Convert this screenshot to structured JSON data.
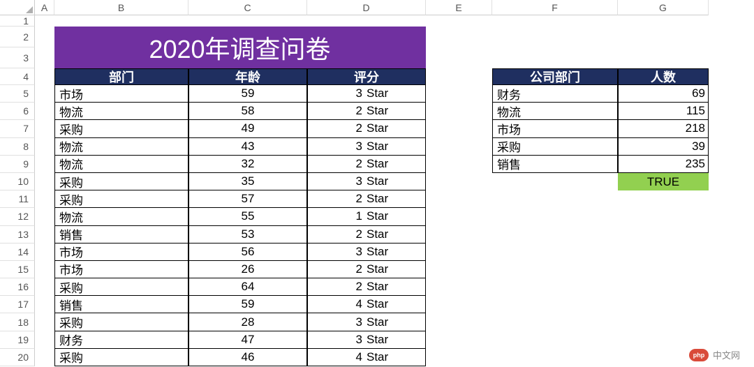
{
  "columns": [
    "A",
    "B",
    "C",
    "D",
    "E",
    "F",
    "G"
  ],
  "row_count": 20,
  "title": "2020年调查问卷",
  "main_table": {
    "headers": [
      "部门",
      "年龄",
      "评分"
    ],
    "rows": [
      {
        "dept": "市场",
        "age": "59",
        "rating_num": "3",
        "rating_txt": "Star"
      },
      {
        "dept": "物流",
        "age": "58",
        "rating_num": "2",
        "rating_txt": "Star"
      },
      {
        "dept": "采购",
        "age": "49",
        "rating_num": "2",
        "rating_txt": "Star"
      },
      {
        "dept": "物流",
        "age": "43",
        "rating_num": "3",
        "rating_txt": "Star"
      },
      {
        "dept": "物流",
        "age": "32",
        "rating_num": "2",
        "rating_txt": "Star"
      },
      {
        "dept": "采购",
        "age": "35",
        "rating_num": "3",
        "rating_txt": "Star"
      },
      {
        "dept": "采购",
        "age": "57",
        "rating_num": "2",
        "rating_txt": "Star"
      },
      {
        "dept": "物流",
        "age": "55",
        "rating_num": "1",
        "rating_txt": "Star"
      },
      {
        "dept": "销售",
        "age": "53",
        "rating_num": "2",
        "rating_txt": "Star"
      },
      {
        "dept": "市场",
        "age": "56",
        "rating_num": "3",
        "rating_txt": "Star"
      },
      {
        "dept": "市场",
        "age": "26",
        "rating_num": "2",
        "rating_txt": "Star"
      },
      {
        "dept": "采购",
        "age": "64",
        "rating_num": "2",
        "rating_txt": "Star"
      },
      {
        "dept": "销售",
        "age": "59",
        "rating_num": "4",
        "rating_txt": "Star"
      },
      {
        "dept": "采购",
        "age": "28",
        "rating_num": "3",
        "rating_txt": "Star"
      },
      {
        "dept": "财务",
        "age": "47",
        "rating_num": "3",
        "rating_txt": "Star"
      },
      {
        "dept": "采购",
        "age": "46",
        "rating_num": "4",
        "rating_txt": "Star"
      }
    ]
  },
  "summary_table": {
    "headers": [
      "公司部门",
      "人数"
    ],
    "rows": [
      {
        "dept": "财务",
        "count": "69"
      },
      {
        "dept": "物流",
        "count": "115"
      },
      {
        "dept": "市场",
        "count": "218"
      },
      {
        "dept": "采购",
        "count": "39"
      },
      {
        "dept": "销售",
        "count": "235"
      }
    ],
    "result": "TRUE"
  },
  "watermark": {
    "logo": "php",
    "text": "中文网"
  }
}
